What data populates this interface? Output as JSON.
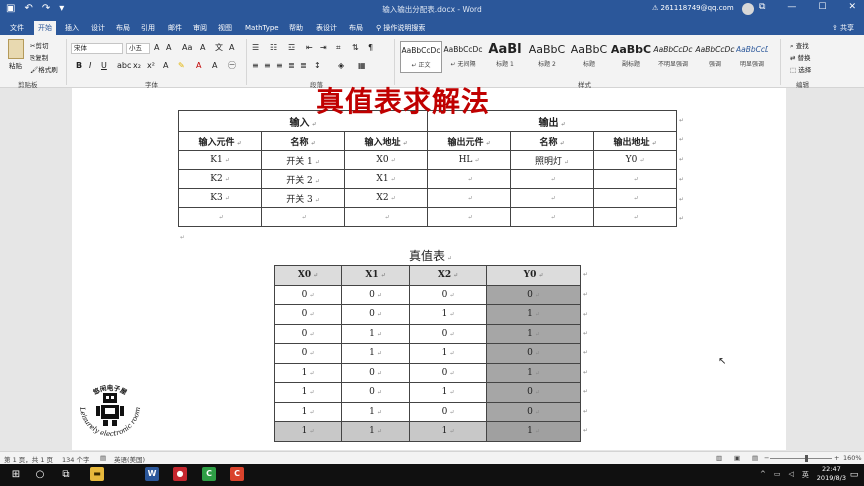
{
  "window": {
    "title": "输入输出分配表.docx - Word",
    "account": "261118749@qq.com",
    "warning_icon": "warning-icon"
  },
  "tabs": [
    "文件",
    "开始",
    "插入",
    "设计",
    "布局",
    "引用",
    "邮件",
    "审阅",
    "视图",
    "MathType",
    "帮助",
    "表设计",
    "布局"
  ],
  "active_tab": "开始",
  "tell_me": "操作说明搜索",
  "share": "共享",
  "ribbon": {
    "clipboard": {
      "paste": "粘贴",
      "cut": "剪切",
      "copy": "复制",
      "format_painter": "格式刷",
      "label": "剪贴板"
    },
    "font": {
      "name": "宋体",
      "size": "小五",
      "label": "字体"
    },
    "paragraph": {
      "label": "段落"
    },
    "styles": {
      "label": "样式",
      "items": [
        {
          "sample": "AaBbCcDc",
          "name": "↵ 正文"
        },
        {
          "sample": "AaBbCcDc",
          "name": "↵ 无间隔"
        },
        {
          "sample": "AaBl",
          "name": "标题 1"
        },
        {
          "sample": "AaBbC",
          "name": "标题 2"
        },
        {
          "sample": "AaBbC",
          "name": "标题"
        },
        {
          "sample": "AaBbC",
          "name": "副标题"
        },
        {
          "sample": "AaBbCcDc",
          "name": "不明显强调"
        },
        {
          "sample": "AaBbCcDc",
          "name": "强调"
        },
        {
          "sample": "AaBbCcDc",
          "name": "明显强调"
        }
      ]
    },
    "editing": {
      "find": "查找",
      "replace": "替换",
      "select": "选择",
      "label": "编辑"
    }
  },
  "document": {
    "overlay_title": "真值表求解法",
    "io_table": {
      "group_headers": [
        "输入",
        "输出"
      ],
      "columns": [
        "输入元件",
        "名称",
        "输入地址",
        "输出元件",
        "名称",
        "输出地址"
      ],
      "rows": [
        [
          "K1",
          "开关 1",
          "X0",
          "HL",
          "照明灯",
          "Y0"
        ],
        [
          "K2",
          "开关 2",
          "X1",
          "",
          "",
          ""
        ],
        [
          "K3",
          "开关 3",
          "X2",
          "",
          "",
          ""
        ],
        [
          "",
          "",
          "",
          "",
          "",
          ""
        ]
      ]
    },
    "truth_table": {
      "caption": "真值表",
      "columns": [
        "X0",
        "X1",
        "X2",
        "Y0"
      ],
      "rows": [
        [
          "0",
          "0",
          "0",
          "0"
        ],
        [
          "0",
          "0",
          "1",
          "1"
        ],
        [
          "0",
          "1",
          "0",
          "1"
        ],
        [
          "0",
          "1",
          "1",
          "0"
        ],
        [
          "1",
          "0",
          "0",
          "1"
        ],
        [
          "1",
          "0",
          "1",
          "0"
        ],
        [
          "1",
          "1",
          "0",
          "0"
        ],
        [
          "1",
          "1",
          "1",
          "1"
        ]
      ]
    },
    "watermark_logo": {
      "chinese": "悠闲电子屋",
      "english": "Leisurely electronic room"
    }
  },
  "status": {
    "page": "第 1 页，共 1 页",
    "words": "134 个字",
    "language": "英语(美国)",
    "zoom": "160%"
  },
  "taskbar": {
    "time": "22:47",
    "date": "2019/8/3"
  }
}
